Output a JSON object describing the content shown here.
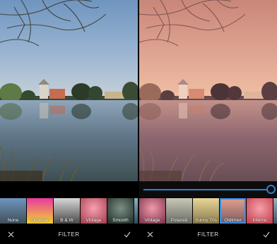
{
  "left_panel": {
    "filters": [
      {
        "label": "None",
        "selected": false,
        "colors": [
          "#6f95bf",
          "#40505a"
        ]
      },
      {
        "label": "Duotone",
        "selected": false,
        "colors": [
          "#e83aa0",
          "#f2d230"
        ]
      },
      {
        "label": "B & W",
        "selected": false,
        "colors": [
          "#d8d8d8",
          "#4a4a4a"
        ]
      },
      {
        "label": "Vintage",
        "selected": false,
        "colors": [
          "#f07a8e",
          "#a23c4c"
        ]
      },
      {
        "label": "Smooth",
        "selected": false,
        "colors": [
          "#5a6e64",
          "#1f2a26"
        ]
      },
      {
        "label": "C",
        "selected": false,
        "colors": [
          "#8fb3c8",
          "#2e4c5e"
        ]
      }
    ],
    "title": "FILTER"
  },
  "right_panel": {
    "slider": {
      "value": 1.0
    },
    "filters": [
      {
        "label": "Vintage",
        "selected": false,
        "colors": [
          "#e0708c",
          "#7a3048"
        ]
      },
      {
        "label": "Polaroid",
        "selected": false,
        "colors": [
          "#c9c8b8",
          "#6a6c64"
        ]
      },
      {
        "label": "Sunny 70s",
        "selected": false,
        "colors": [
          "#e8d69a",
          "#8a7a48"
        ]
      },
      {
        "label": "Oldtimer",
        "selected": true,
        "colors": [
          "#e3a08e",
          "#7a5a60"
        ]
      },
      {
        "label": "Inferno",
        "selected": false,
        "colors": [
          "#f07a82",
          "#c03a4a"
        ]
      },
      {
        "label": "S",
        "selected": false,
        "colors": [
          "#9ab0c0",
          "#3e5466"
        ]
      }
    ],
    "title": "FILTER"
  },
  "icons": {
    "cancel": "close-icon",
    "apply": "checkmark-icon"
  },
  "colors": {
    "accent": "#2f7fd0",
    "background": "#000000"
  }
}
